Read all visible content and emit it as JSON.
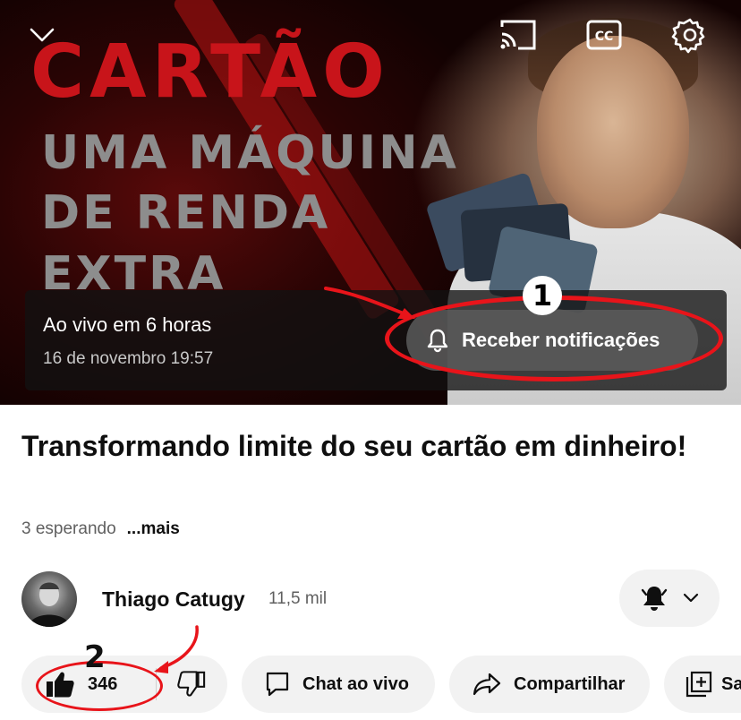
{
  "thumbnail": {
    "headline": "CARTÃO",
    "lines": [
      "UMA MÁQUINA",
      "DE RENDA",
      "EXTRA"
    ]
  },
  "live": {
    "title": "Ao vivo em 6 horas",
    "date": "16 de novembro 19:57",
    "notify_label": "Receber notificações"
  },
  "annotations": {
    "one": "1",
    "two": "2"
  },
  "video": {
    "title": "Transformando limite do seu cartão em dinheiro!",
    "waiting": "3 esperando",
    "more": "...mais"
  },
  "channel": {
    "name": "Thiago Catugy",
    "subscribers": "11,5 mil"
  },
  "actions": {
    "like_count": "346",
    "chat_label": "Chat ao vivo",
    "share_label": "Compartilhar",
    "save_label": "Sa"
  },
  "colors": {
    "accent_red": "#e8141a",
    "thumb_red": "#c8141a",
    "pill_bg": "#f2f2f2"
  }
}
